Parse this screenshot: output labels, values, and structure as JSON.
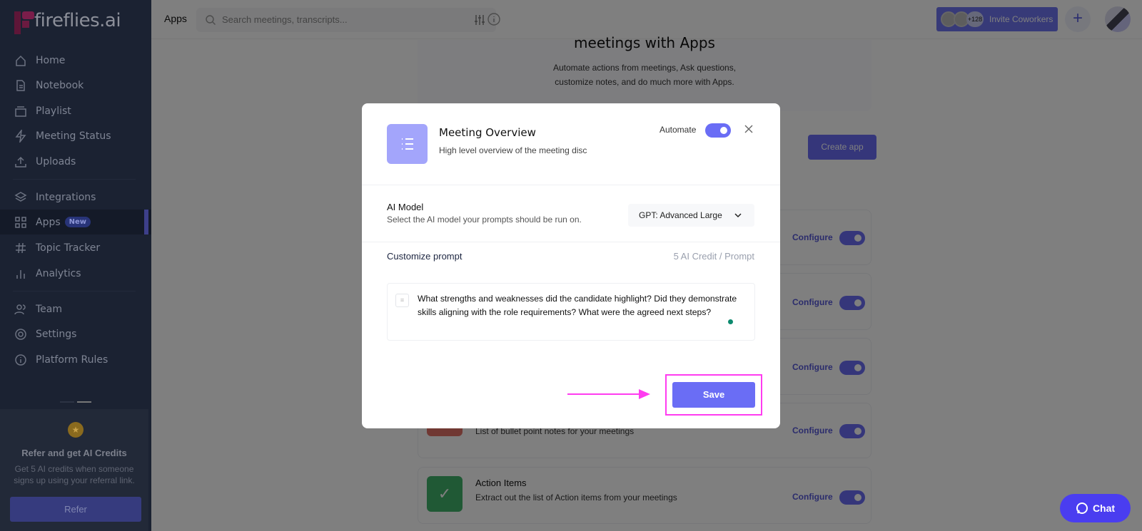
{
  "brand": {
    "name": "fireflies.ai",
    "accent": "#6a6df5",
    "logo_color": "#8a1d4b"
  },
  "sidebar": {
    "items": [
      {
        "label": "Home",
        "icon": "home-icon"
      },
      {
        "label": "Notebook",
        "icon": "document-icon"
      },
      {
        "label": "Playlist",
        "icon": "playlist-icon"
      },
      {
        "label": "Meeting Status",
        "icon": "lightning-icon"
      },
      {
        "label": "Uploads",
        "icon": "upload-icon"
      },
      {
        "label": "Integrations",
        "icon": "layers-icon"
      },
      {
        "label": "Apps",
        "icon": "grid-icon",
        "badge": "New",
        "active": true
      },
      {
        "label": "Topic Tracker",
        "icon": "hash-icon"
      },
      {
        "label": "Analytics",
        "icon": "bar-chart-icon"
      },
      {
        "label": "Team",
        "icon": "users-icon"
      },
      {
        "label": "Settings",
        "icon": "gear-icon"
      },
      {
        "label": "Platform Rules",
        "icon": "info-icon"
      }
    ],
    "refer": {
      "title": "Refer and get AI Credits",
      "text_line1": "Get 5 AI credits when someone",
      "text_line2": "signs up using your referral link.",
      "button": "Refer"
    }
  },
  "topbar": {
    "title": "Apps",
    "search_placeholder": "Search meetings, transcripts...",
    "invite_count": "+128",
    "invite_label": "Invite Coworkers",
    "add_icon": "plus-icon"
  },
  "hero": {
    "title": "meetings with Apps",
    "desc_line1": "Automate actions from meetings, Ask questions,",
    "desc_line2": "customize notes, and do much more with Apps."
  },
  "create_app": "Create app",
  "apps": [
    {
      "configure": "Configure",
      "enabled": true
    },
    {
      "configure": "Configure",
      "enabled": true
    },
    {
      "configure": "Configure",
      "enabled": true
    },
    {
      "desc": "List of bullet point notes for your meetings",
      "configure": "Configure",
      "enabled": true,
      "color": "#e07166"
    },
    {
      "name": "Action Items",
      "desc": "Extract out the list of Action items from your meetings",
      "configure": "Configure",
      "enabled": true,
      "color": "#41b36a"
    }
  ],
  "modal": {
    "title": "Meeting Overview",
    "subtitle": "High level overview of the meeting disc",
    "automate_label": "Automate",
    "automate_on": true,
    "ai_model_label": "AI Model",
    "ai_model_desc": "Select the AI model your prompts should be run on.",
    "ai_model_value": "GPT: Advanced Large",
    "prompt_label": "Customize prompt",
    "credit_text": "5 AI Credit / Prompt",
    "prompt_text": "What strengths and weaknesses did the candidate highlight? Did they demonstrate skills aligning with the role requirements? What were the agreed next steps?",
    "save": "Save",
    "highlight_color": "#ff3cf0"
  },
  "chat": {
    "label": "Chat",
    "color": "#4a3df0"
  }
}
